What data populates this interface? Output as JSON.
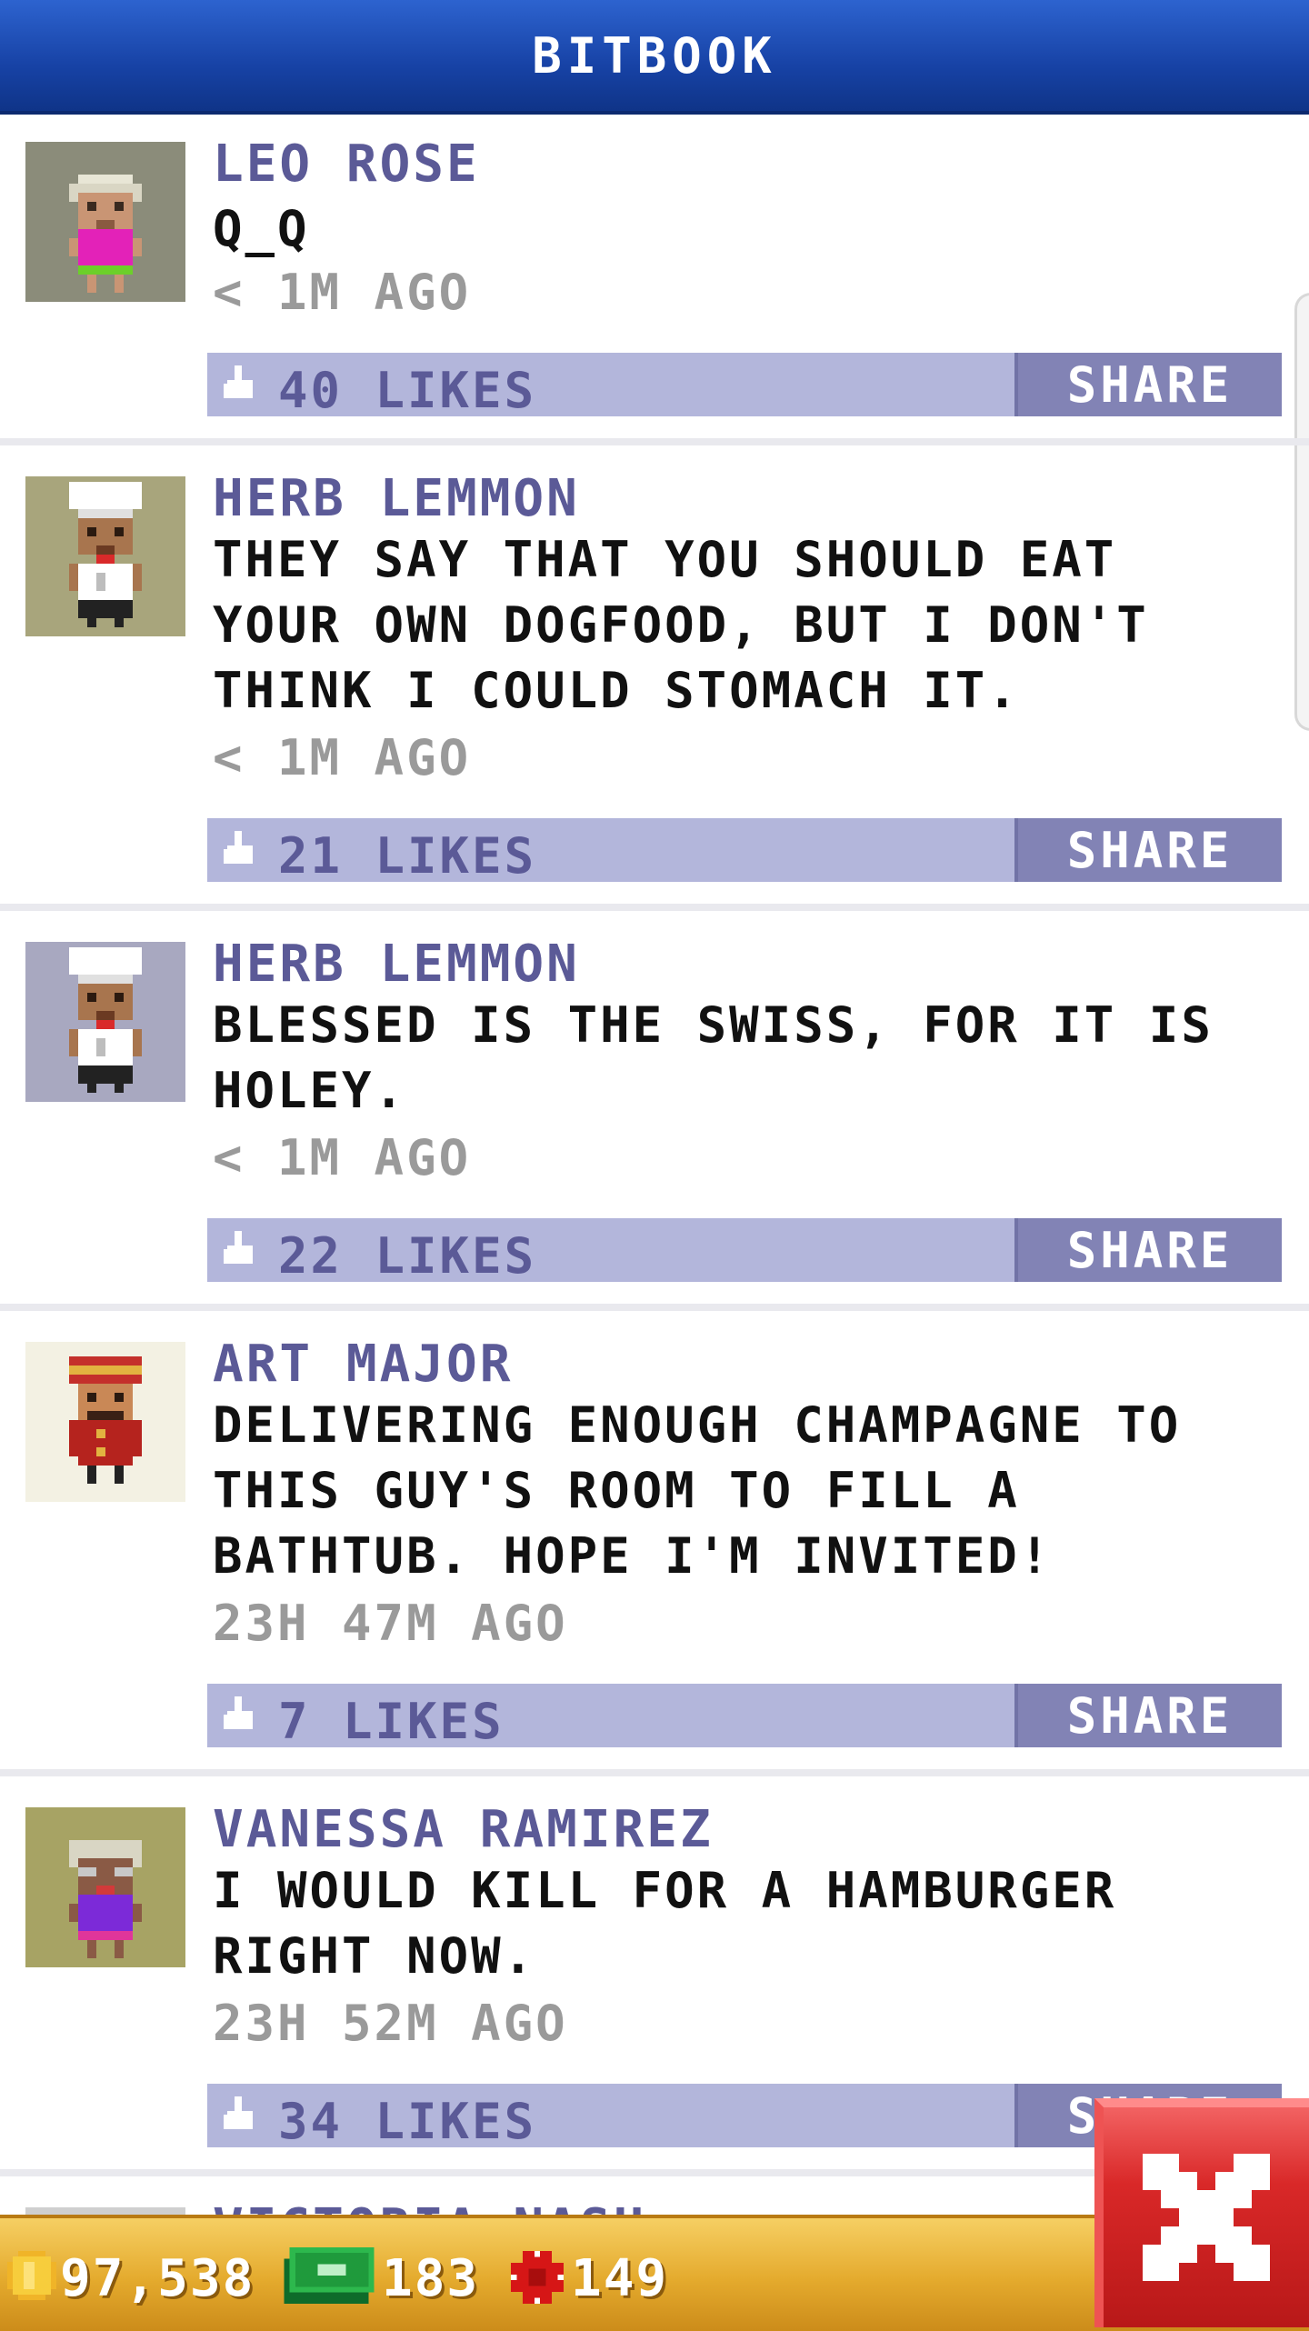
{
  "header": {
    "title": "BITBOOK"
  },
  "posts": [
    {
      "author": "LEO ROSE",
      "message": "Q_Q",
      "time": "< 1M AGO",
      "likes": "40 LIKES",
      "share": "SHARE",
      "avatar": "elderly-woman-pink-shirt",
      "avatar_bg": "#8b8c7a"
    },
    {
      "author": "HERB LEMMON",
      "message": "THEY SAY THAT YOU SHOULD EAT YOUR OWN DOGFOOD, BUT I DON'T THINK I COULD STOMACH IT.",
      "time": "< 1M AGO",
      "likes": "21 LIKES",
      "share": "SHARE",
      "avatar": "chef",
      "avatar_bg": "#a8a57c"
    },
    {
      "author": "HERB LEMMON",
      "message": "BLESSED IS THE SWISS, FOR IT IS HOLEY.",
      "time": "< 1M AGO",
      "likes": "22 LIKES",
      "share": "SHARE",
      "avatar": "chef",
      "avatar_bg": "#a8a8c0"
    },
    {
      "author": "ART MAJOR",
      "message": "DELIVERING ENOUGH CHAMPAGNE TO THIS GUY'S ROOM TO FILL A BATHTUB. HOPE I'M INVITED!",
      "time": "23H 47M AGO",
      "likes": "7 LIKES",
      "share": "SHARE",
      "avatar": "bellhop",
      "avatar_bg": "#f3f1e3"
    },
    {
      "author": "VANESSA RAMIREZ",
      "message": "I WOULD KILL FOR A HAMBURGER RIGHT NOW.",
      "time": "23H 52M AGO",
      "likes": "34 LIKES",
      "share": "SHARE",
      "avatar": "elderly-woman-purple-shirt",
      "avatar_bg": "#a7a364"
    }
  ],
  "partial_post": {
    "author": "VICTORIA NASH"
  },
  "status_bar": {
    "coins": "97,538",
    "bux": "183",
    "tokens": "149"
  },
  "icons": {
    "coins": "gold-coin-icon",
    "bux": "money-bill-icon",
    "tokens": "red-chip-icon",
    "close": "close-x-icon",
    "like": "thumbs-up-icon"
  }
}
